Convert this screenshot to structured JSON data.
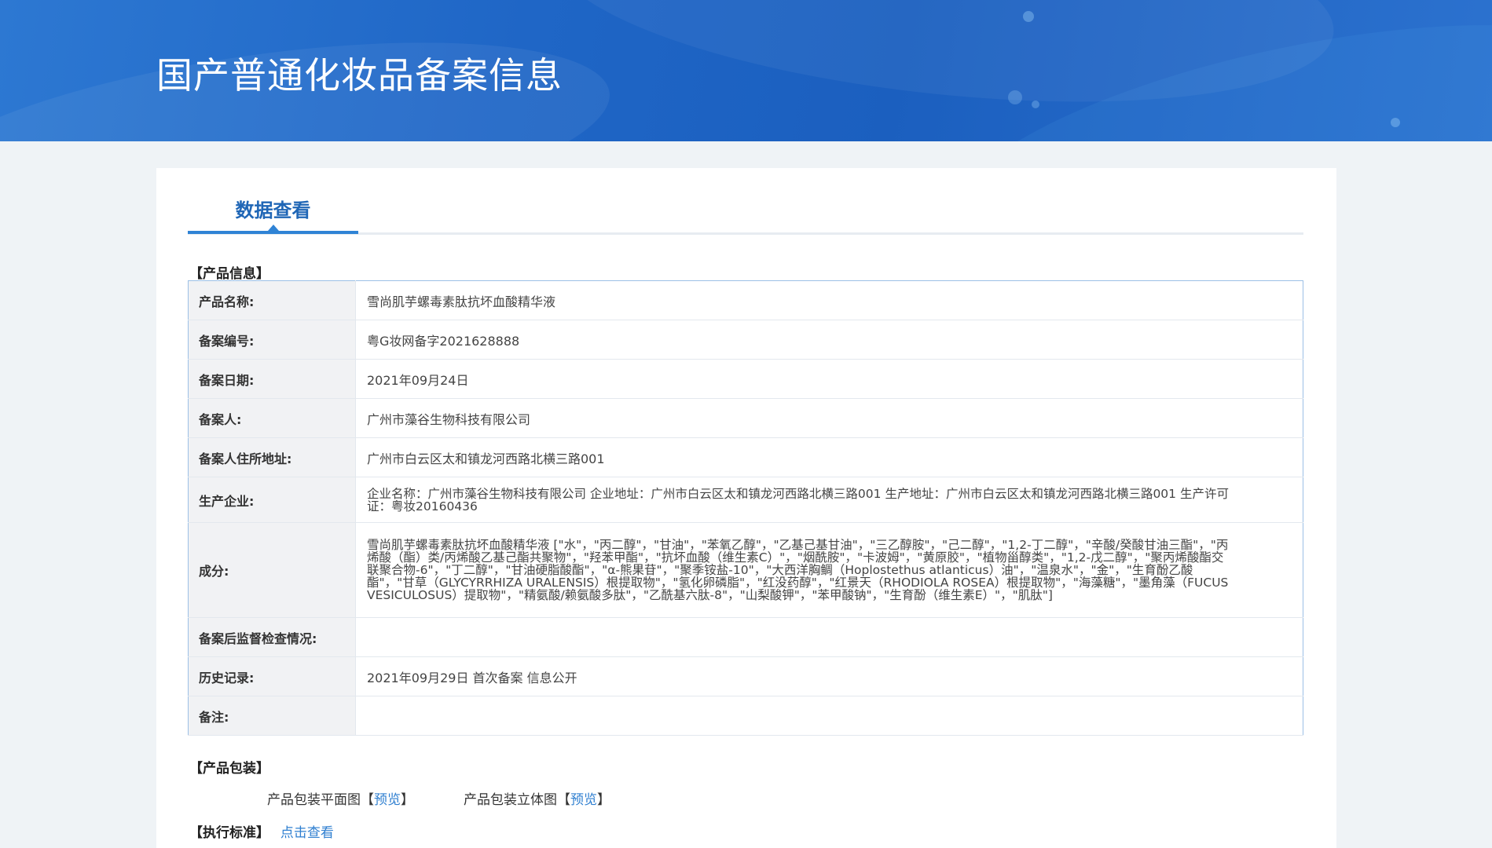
{
  "header": {
    "title": "国产普通化妆品备案信息"
  },
  "tab": {
    "label": "数据查看"
  },
  "sections": {
    "product_info": "【产品信息】",
    "packaging": "【产品包装】",
    "standard": "【执行标准】"
  },
  "rows": [
    {
      "key": "产品名称:",
      "value": "雪尚肌芋螺毒素肽抗坏血酸精华液"
    },
    {
      "key": "备案编号:",
      "value": "粤G妆网备字2021628888"
    },
    {
      "key": "备案日期:",
      "value": "2021年09月24日"
    },
    {
      "key": "备案人:",
      "value": "广州市藻谷生物科技有限公司"
    },
    {
      "key": "备案人住所地址:",
      "value": "广州市白云区太和镇龙河西路北横三路001"
    },
    {
      "key": "生产企业:",
      "value": "企业名称：广州市藻谷生物科技有限公司 企业地址：广州市白云区太和镇龙河西路北横三路001 生产地址：广州市白云区太和镇龙河西路北横三路001 生产许可证：粤妆20160436"
    },
    {
      "key": "成分:",
      "value": "雪尚肌芋螺毒素肽抗坏血酸精华液 [\"水\"，\"丙二醇\"，\"甘油\"，\"苯氧乙醇\"，\"乙基己基甘油\"，\"三乙醇胺\"，\"己二醇\"，\"1,2-丁二醇\"，\"辛酸/癸酸甘油三酯\"，\"丙烯酸（酯）类/丙烯酸乙基己酯共聚物\"，\"羟苯甲酯\"，\"抗坏血酸（维生素C）\"，\"烟酰胺\"，\"卡波姆\"，\"黄原胶\"，\"植物甾醇类\"，\"1,2-戊二醇\"，\"聚丙烯酸酯交联聚合物-6\"，\"丁二醇\"，\"甘油硬脂酸酯\"，\"α-熊果苷\"，\"聚季铵盐-10\"，\"大西洋胸鲷（Hoplostethus atlanticus）油\"，\"温泉水\"，\"金\"，\"生育酚乙酸酯\"，\"甘草（GLYCYRRHIZA URALENSIS）根提取物\"，\"氢化卵磷脂\"，\"红没药醇\"，\"红景天（RHODIOLA ROSEA）根提取物\"，\"海藻糖\"，\"墨角藻（FUCUS VESICULOSUS）提取物\"，\"精氨酸/赖氨酸多肽\"，\"乙酰基六肽-8\"，\"山梨酸钾\"，\"苯甲酸钠\"，\"生育酚（维生素E）\"，\"肌肽\"]"
    },
    {
      "key": "备案后监督检查情况:",
      "value": ""
    },
    {
      "key": "历史记录:",
      "value": "2021年09月29日 首次备案 信息公开"
    },
    {
      "key": "备注:",
      "value": ""
    }
  ],
  "packaging": {
    "flat_label": "产品包装平面图",
    "solid_label": "产品包装立体图",
    "bracket_open": "【",
    "bracket_close": "】",
    "preview": "预览"
  },
  "standard": {
    "link": "点击查看"
  }
}
